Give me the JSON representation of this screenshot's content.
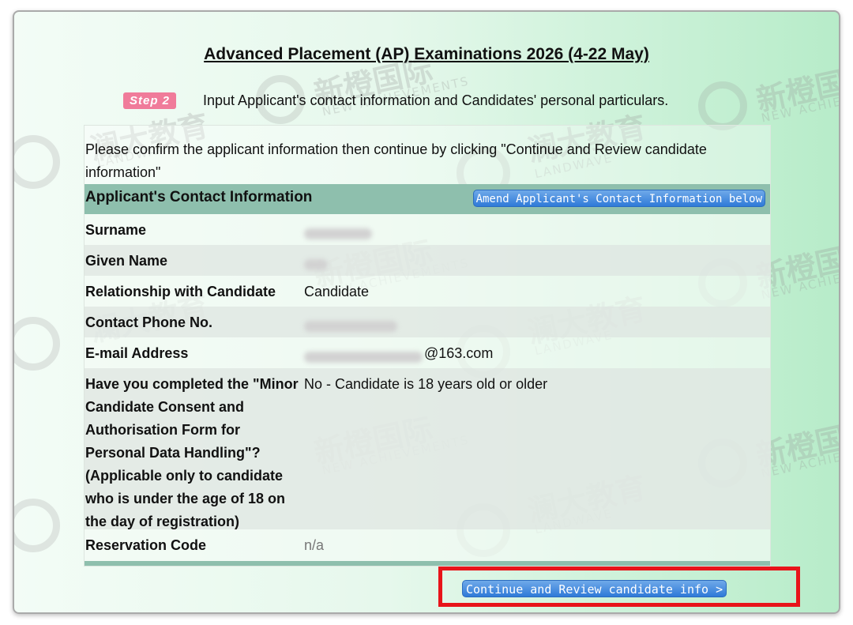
{
  "header": {
    "title": "Advanced Placement (AP) Examinations 2026 (4-22 May)"
  },
  "step": {
    "badge": "Step 2",
    "instruction": "Input Applicant's contact information and Candidates' personal particulars."
  },
  "intro": {
    "text": "Please confirm the applicant information then continue by clicking \"Continue and Review candidate information\""
  },
  "section": {
    "title": "Applicant's Contact Information",
    "amend_label": "Amend Applicant's Contact Information below"
  },
  "fields": {
    "surname_label": "Surname",
    "given_name_label": "Given Name",
    "relationship_label": "Relationship with Candidate",
    "relationship_value": "Candidate",
    "phone_label": "Contact Phone No.",
    "email_label": "E-mail Address",
    "email_domain": "@163.com",
    "consent_label": "Have you completed the \"Minor Candidate Consent and Authorisation Form for Personal Data Handling\"? (Applicable only to candidate who is under the age of 18 on the day of registration)",
    "consent_value": "No - Candidate is 18 years old or older",
    "reservation_label": "Reservation Code",
    "reservation_value": "n/a"
  },
  "actions": {
    "continue_label": "Continue and Review candidate info >"
  },
  "watermarks": {
    "cn_1": "新橙国际",
    "en_1": "NEW ACHIEVEMENTS",
    "cn_2": "澜大教育",
    "en_2": "LANDWAVE"
  },
  "colors": {
    "section_header": "#8ebfad",
    "button_blue": "#2f7ad8",
    "highlight_red": "#e8141a",
    "step_badge": "#f07b9a"
  }
}
